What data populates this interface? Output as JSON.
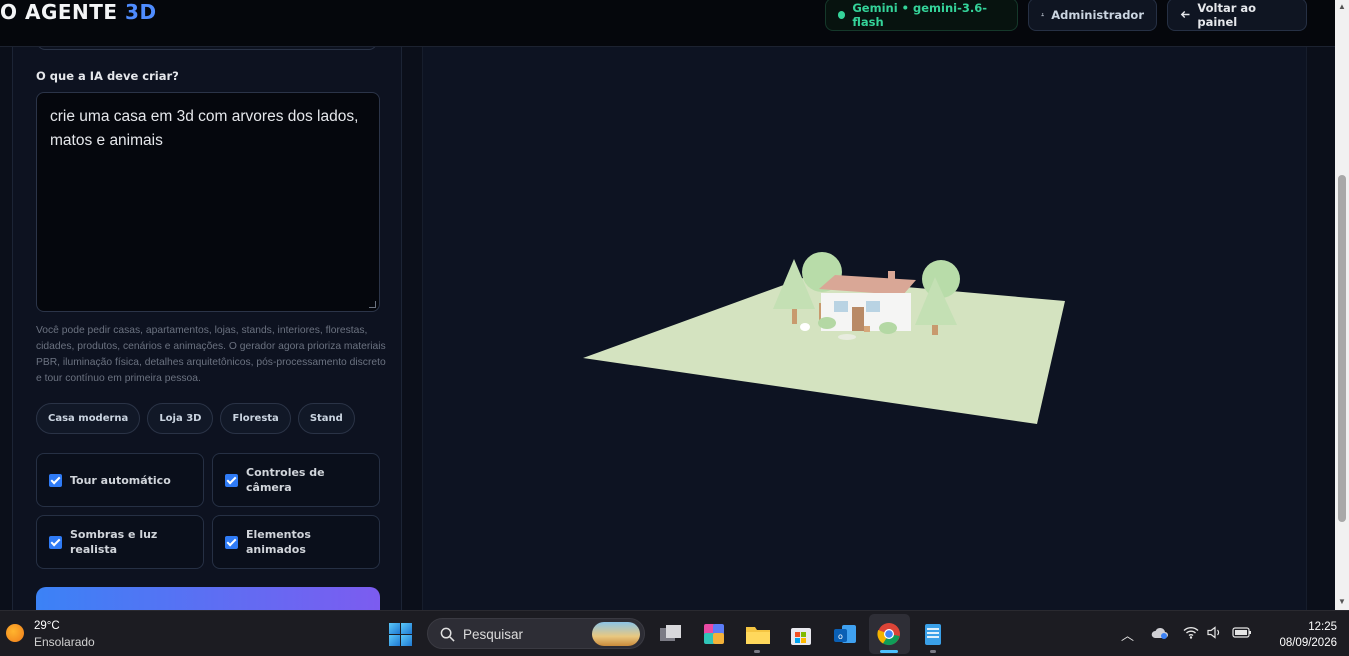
{
  "header": {
    "brand_main": "O AGENTE",
    "brand_accent": "3D",
    "model_status": "Gemini • gemini-3.6-flash",
    "user_label": "Administrador",
    "back_label": "Voltar ao painel",
    "back_icon": "arrow-left-icon",
    "user_icon": "user-icon"
  },
  "form": {
    "prompt_label": "O que a IA deve criar?",
    "prompt_value": "crie uma casa em 3d com arvores dos lados, matos e animais",
    "help_text": "Você pode pedir casas, apartamentos, lojas, stands, interiores, florestas, cidades, produtos, cenários e animações. O gerador agora prioriza materiais PBR, iluminação física, detalhes arquitetônicos, pós-processamento discreto e tour contínuo em primeira pessoa.",
    "presets": [
      "Casa moderna",
      "Loja 3D",
      "Floresta",
      "Stand"
    ],
    "options": [
      {
        "label": "Tour automático",
        "checked": true
      },
      {
        "label": "Controles de câmera",
        "checked": true
      },
      {
        "label": "Sombras e luz realista",
        "checked": true
      },
      {
        "label": "Elementos animados",
        "checked": true
      }
    ]
  },
  "colors": {
    "accent": "#4f8cff",
    "status_green": "#34d399",
    "ground": "#d4e3c0",
    "tree": "#b8dca9",
    "roof": "#d9a796"
  },
  "taskbar": {
    "temperature": "29°C",
    "weather": "Ensolarado",
    "search_placeholder": "Pesquisar",
    "time": "12:25",
    "date": "08/09/2026"
  }
}
